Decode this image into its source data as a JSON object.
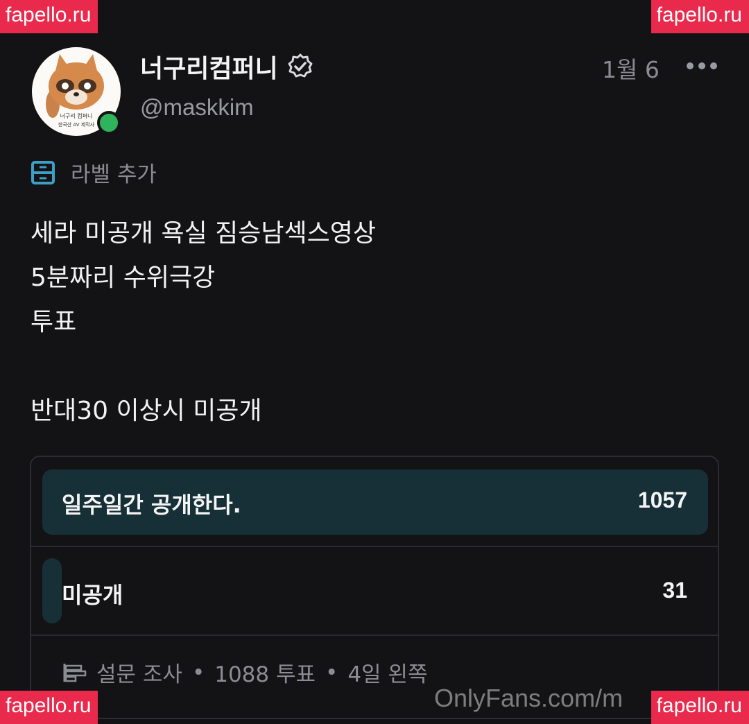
{
  "watermarks": {
    "top_left": "fapello.ru",
    "top_right": "fapello.ru",
    "bottom_left": "fapello.ru",
    "bottom_right": "fapello.ru",
    "bottom_text": "OnlyFans.com/m"
  },
  "profile": {
    "name": "너구리컴퍼니",
    "handle": "@maskkim",
    "date": "1월 6",
    "avatar_caption_1": "너구리 컴퍼니",
    "avatar_caption_2": "한국산 AV 제작사",
    "verified_icon": "verified-badge-icon"
  },
  "label": {
    "text": "라벨 추가",
    "icon": "label-icon"
  },
  "post": {
    "lines": [
      "세라 미공개 욕실 짐승남섹스영상",
      "5분짜리 수위극강",
      "투표",
      "",
      "반대30 이상시 미공개"
    ]
  },
  "poll": {
    "options": [
      {
        "label": "일주일간 공개한다.",
        "count": "1057",
        "share": 0.971
      },
      {
        "label": "미공개",
        "count": "31",
        "share": 0.028
      }
    ],
    "footer": {
      "type": "설문 조사",
      "votes": "1088 투표",
      "remaining": "4일 왼쪽",
      "separator": "•"
    }
  },
  "colors": {
    "background": "#131316",
    "poll_fill": "#173038",
    "online": "#2fb35c",
    "watermark": "#ea2a4c"
  }
}
